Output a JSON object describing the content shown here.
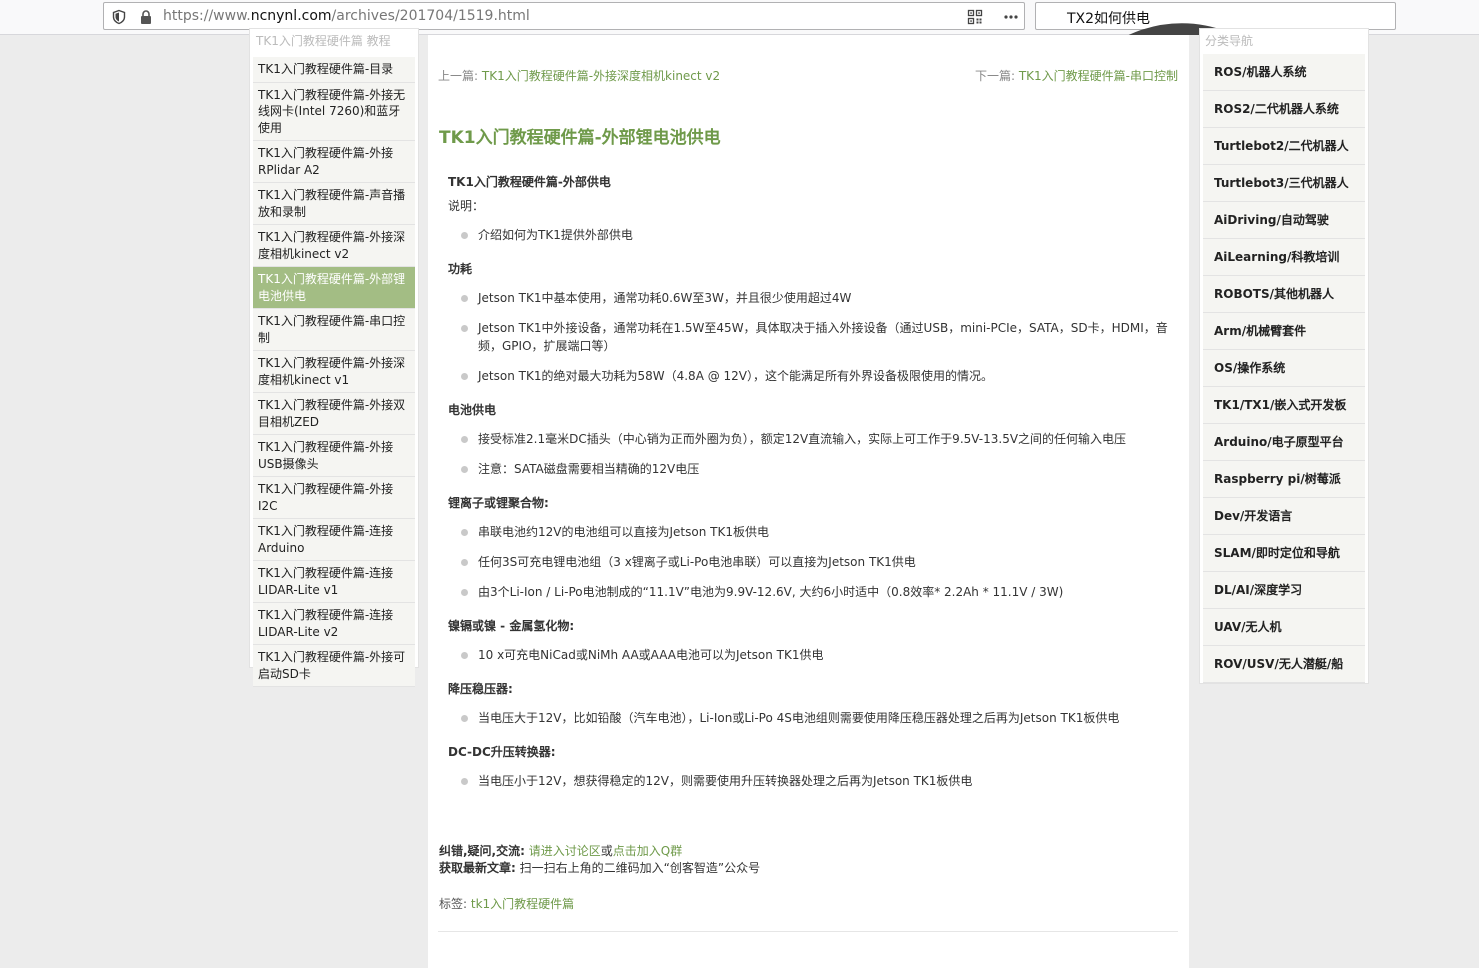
{
  "browser": {
    "url_prefix": "https://www.",
    "url_host": "ncnynl.com",
    "url_path": "/archives/201704/1519.html",
    "search_value": "TX2如何供电"
  },
  "left_sidebar": {
    "heading": "TK1入门教程硬件篇 教程",
    "items": [
      {
        "label": "TK1入门教程硬件篇-目录",
        "active": false
      },
      {
        "label": "TK1入门教程硬件篇-外接无线网卡(Intel 7260)和蓝牙使用",
        "active": false
      },
      {
        "label": "TK1入门教程硬件篇-外接RPlidar A2",
        "active": false
      },
      {
        "label": "TK1入门教程硬件篇-声音播放和录制",
        "active": false
      },
      {
        "label": "TK1入门教程硬件篇-外接深度相机kinect v2",
        "active": false
      },
      {
        "label": "TK1入门教程硬件篇-外部锂电池供电",
        "active": true
      },
      {
        "label": "TK1入门教程硬件篇-串口控制",
        "active": false
      },
      {
        "label": "TK1入门教程硬件篇-外接深度相机kinect v1",
        "active": false
      },
      {
        "label": "TK1入门教程硬件篇-外接双目相机ZED",
        "active": false
      },
      {
        "label": "TK1入门教程硬件篇-外接USB摄像头",
        "active": false
      },
      {
        "label": "TK1入门教程硬件篇-外接I2C",
        "active": false
      },
      {
        "label": "TK1入门教程硬件篇-连接Arduino",
        "active": false
      },
      {
        "label": "TK1入门教程硬件篇-连接LIDAR-Lite v1",
        "active": false
      },
      {
        "label": "TK1入门教程硬件篇-连接LIDAR-Lite v2",
        "active": false
      },
      {
        "label": "TK1入门教程硬件篇-外接可启动SD卡",
        "active": false
      }
    ]
  },
  "nav": {
    "prev_label": "上一篇:",
    "prev_link": "TK1入门教程硬件篇-外接深度相机kinect v2",
    "next_label": "下一篇:",
    "next_link": "TK1入门教程硬件篇-串口控制"
  },
  "article": {
    "title": "TK1入门教程硬件篇-外部锂电池供电",
    "intro_heading": "TK1入门教程硬件篇-外部供电",
    "intro_note": "说明：",
    "sections": [
      {
        "heading": "",
        "items": [
          "介绍如何为TK1提供外部供电"
        ]
      },
      {
        "heading": "功耗",
        "items": [
          "Jetson TK1中基本使用，通常功耗0.6W至3W，并且很少使用超过4W",
          "Jetson TK1中外接设备，通常功耗在1.5W至45W，具体取决于插入外接设备（通过USB，mini-PCIe，SATA，SD卡，HDMI，音频，GPIO，扩展端口等）",
          "Jetson TK1的绝对最大功耗为58W（4.8A @ 12V），这个能满足所有外界设备极限使用的情况。"
        ]
      },
      {
        "heading": "电池供电",
        "items": [
          "接受标准2.1毫米DC插头（中心销为正而外圈为负），额定12V直流输入，实际上可工作于9.5V-13.5V之间的任何输入电压",
          "注意：SATA磁盘需要相当精确的12V电压"
        ]
      },
      {
        "heading": "锂离子或锂聚合物:",
        "items": [
          "串联电池约12V的电池组可以直接为Jetson TK1板供电",
          "任何3S可充电锂电池组（3 x锂离子或Li-Po电池串联）可以直接为Jetson TK1供电",
          "由3个Li-Ion / Li-Po电池制成的“11.1V”电池为9.9V-12.6V, 大约6小时适中（0.8效率* 2.2Ah * 11.1V / 3W)"
        ]
      },
      {
        "heading": "镍镉或镍 - 金属氢化物:",
        "items": [
          "10 x可充电NiCad或NiMh AA或AAA电池可以为Jetson TK1供电"
        ]
      },
      {
        "heading": "降压稳压器:",
        "items": [
          "当电压大于12V，比如铅酸（汽车电池），Li-Ion或Li-Po 4S电池组则需要使用降压稳压器处理之后再为Jetson TK1板供电"
        ]
      },
      {
        "heading": "DC-DC升压转换器:",
        "items": [
          "当电压小于12V，想获得稳定的12V，则需要使用升压转换器处理之后再为Jetson TK1板供电"
        ]
      }
    ]
  },
  "footer": {
    "feedback_label": "纠错,疑问,交流:",
    "feedback_link1": "请进入讨论区",
    "feedback_or": "或",
    "feedback_link2": "点击加入Q群",
    "latest_label": "获取最新文章:",
    "latest_text": "扫一扫右上角的二维码加入“创客智造”公众号",
    "tags_label": "标签:",
    "tag": "tk1入门教程硬件篇"
  },
  "right_sidebar": {
    "heading": "分类导航",
    "items": [
      "ROS/机器人系统",
      "ROS2/二代机器人系统",
      "Turtlebot2/二代机器人",
      "Turtlebot3/三代机器人",
      "AiDriving/自动驾驶",
      "AiLearning/科教培训",
      "ROBOTS/其他机器人",
      "Arm/机械臂套件",
      "OS/操作系统",
      "TK1/TX1/嵌入式开发板",
      "Arduino/电子原型平台",
      "Raspberry pi/树莓派",
      "Dev/开发语言",
      "SLAM/即时定位和导航",
      "DL/AI/深度学习",
      "UAV/无人机",
      "ROV/USV/无人潜艇/船"
    ]
  }
}
